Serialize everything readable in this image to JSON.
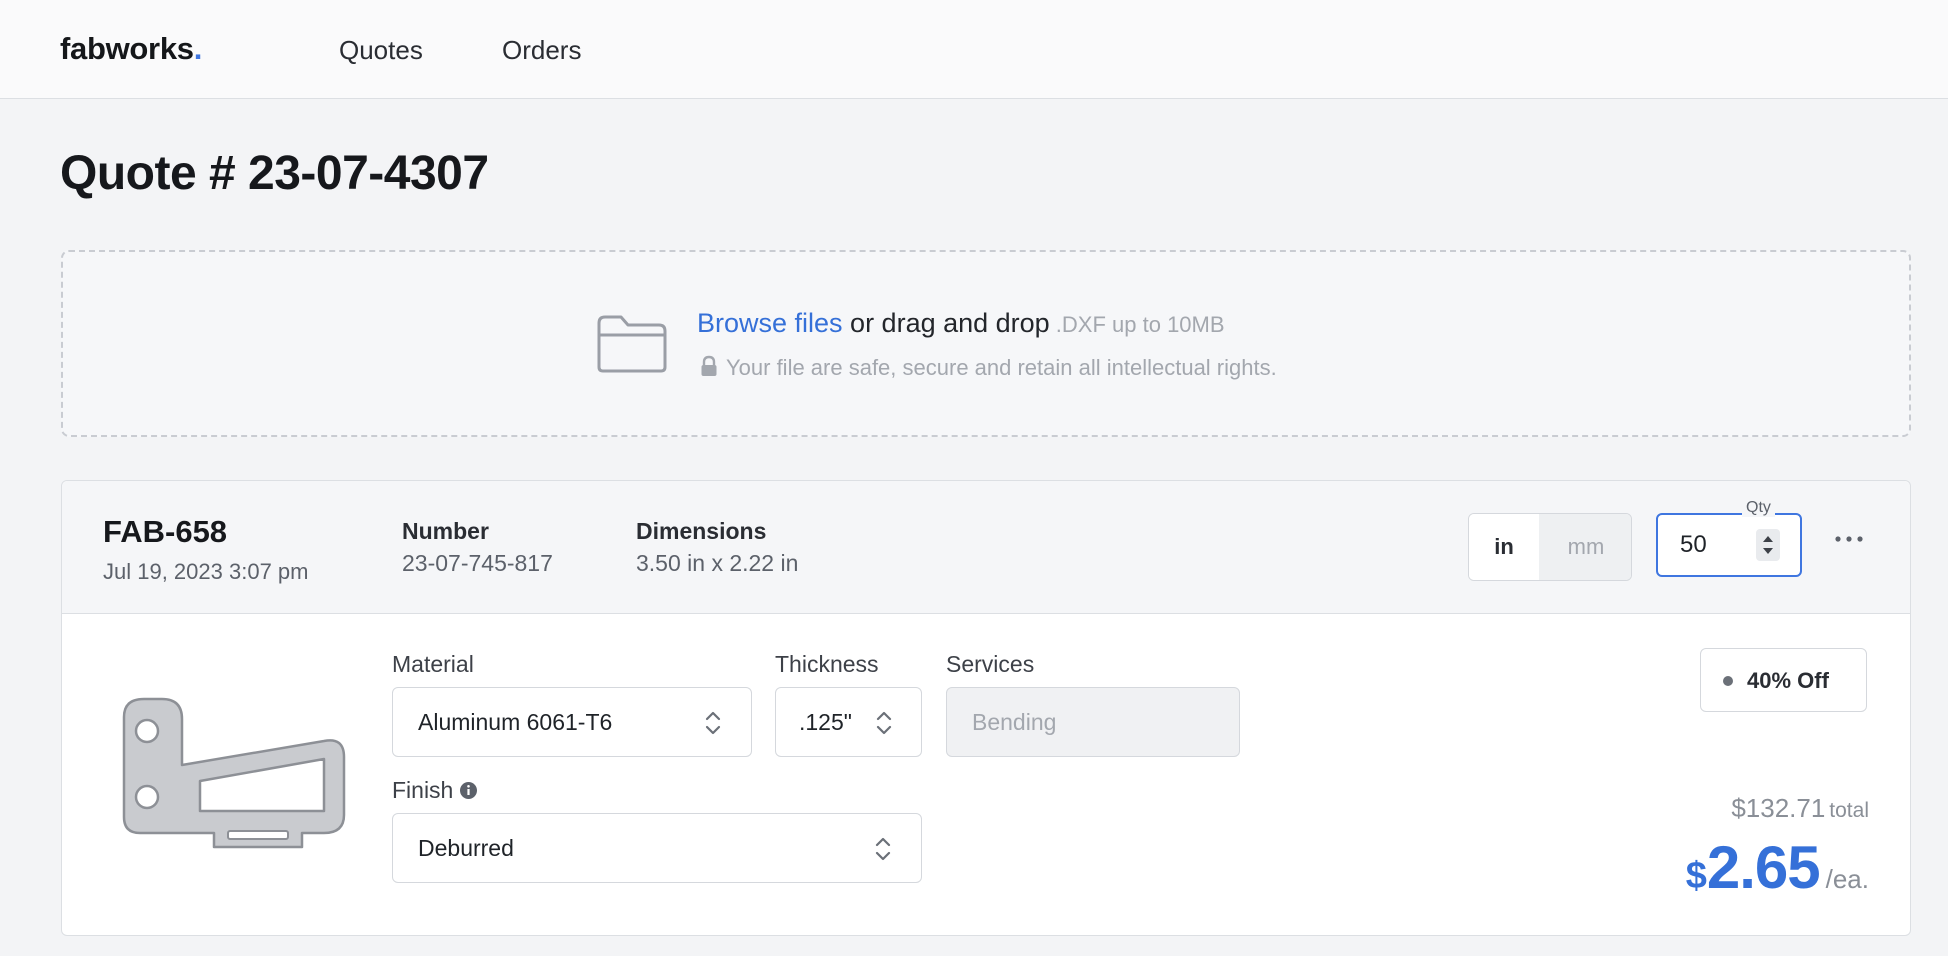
{
  "nav": {
    "brand": "fabworks",
    "brand_dot": ".",
    "links": [
      {
        "label": "Quotes"
      },
      {
        "label": "Orders"
      }
    ]
  },
  "page": {
    "title": "Quote # 23-07-4307"
  },
  "dropzone": {
    "browse_label": "Browse files",
    "drag_text": " or drag and drop",
    "hint": " .DXF up to 10MB",
    "note": "Your file are safe, secure and retain all intellectual rights."
  },
  "part": {
    "id": "FAB-658",
    "date": "Jul 19, 2023 3:07 pm",
    "number_label": "Number",
    "number_value": "23-07-745-817",
    "dimensions_label": "Dimensions",
    "dimensions_value": "3.50 in x 2.22 in",
    "units": {
      "in": "in",
      "mm": "mm",
      "selected": "in"
    },
    "qty": {
      "label": "Qty",
      "value": "50"
    },
    "material": {
      "label": "Material",
      "value": "Aluminum 6061-T6"
    },
    "thickness": {
      "label": "Thickness",
      "value": ".125\""
    },
    "services": {
      "label": "Services",
      "placeholder": "Bending"
    },
    "finish": {
      "label": "Finish",
      "value": "Deburred"
    },
    "discount": "40% Off",
    "total_amount": "$132.71",
    "total_suffix": "total",
    "price_currency": "$",
    "price_value": "2.65",
    "price_suffix": "/ea."
  },
  "colors": {
    "accent": "#3f76e0",
    "link": "#3570d8",
    "border": "#dcdfe3",
    "background": "#f3f4f6"
  }
}
